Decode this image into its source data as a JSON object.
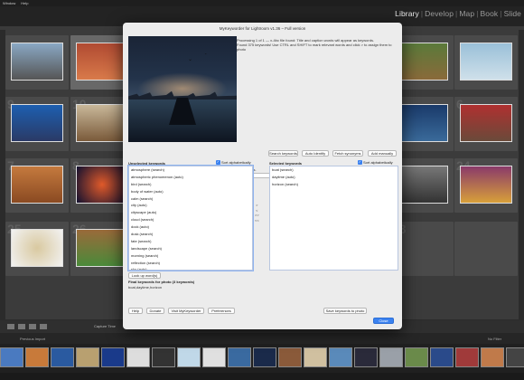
{
  "menubar": {
    "items": [
      "Window",
      "Help"
    ]
  },
  "modules": {
    "items": [
      "Library",
      "Develop",
      "Map",
      "Book",
      "Slide"
    ],
    "active": "Library",
    "separator": "|"
  },
  "grid": {
    "cell_numbers": [
      "9",
      "10",
      "5",
      "6",
      "7",
      "8",
      "23",
      "24",
      "25",
      "26"
    ]
  },
  "toolbar": {
    "sort_label": "Capture Time"
  },
  "filmstrip": {
    "source_label": "Previous Import",
    "filter_label": "No Filter"
  },
  "dialog": {
    "title": "MyKeyworder for Lightroom v1.36 – Full version",
    "info_lines": [
      "Processing 1 of 1 — x-4bc file found: Title and caption words will appear as keywords.",
      "Found 375 keywords! Use CTRL and SHIFT to mark relevant words and click > to assign them to",
      "photo"
    ],
    "search_hint": "Enter search terms separated by space. Use minus (-) in front to exclude words.",
    "search_value": "sunrise",
    "buttons": {
      "search": "Search keywords",
      "auto_identify": "Auto Identify",
      "fetch_synonyms": "Fetch synonyms",
      "add_manually": "Add manually",
      "lookup": "Look up word(s)",
      "help": "Help",
      "donate": "Donate",
      "visit": "Visit MyKeyworder",
      "preferences": "Preferences",
      "save": "Save keywords to photo",
      "close": "Close"
    },
    "unselected": {
      "heading": "Unselected keywords",
      "sort_label": "Sort alphabetically",
      "sort_checked": true,
      "items": [
        "atmosphere (search)",
        "atmospheric phenomenon (auto)",
        "bird (search)",
        "body of water (auto)",
        "calm (search)",
        "city (auto)",
        "cityscape (auto)",
        "cloud (search)",
        "dock (auto)",
        "dusk (search)",
        "fate (search)",
        "landscape (search)",
        "morning (search)",
        "reflection (search)",
        "sky (auto)"
      ]
    },
    "selected": {
      "heading": "Selected keywords",
      "sort_label": "Sort alphabetically",
      "sort_checked": true,
      "items": [
        "boat (search)",
        "daytime (auto)",
        "horizon (search)"
      ]
    },
    "move_arrows": [
      ">",
      "<",
      ">>",
      "<<"
    ],
    "final_heading": "Final keywords for photo (3 keywords)",
    "final_value": "boat,daytime,horizon"
  }
}
